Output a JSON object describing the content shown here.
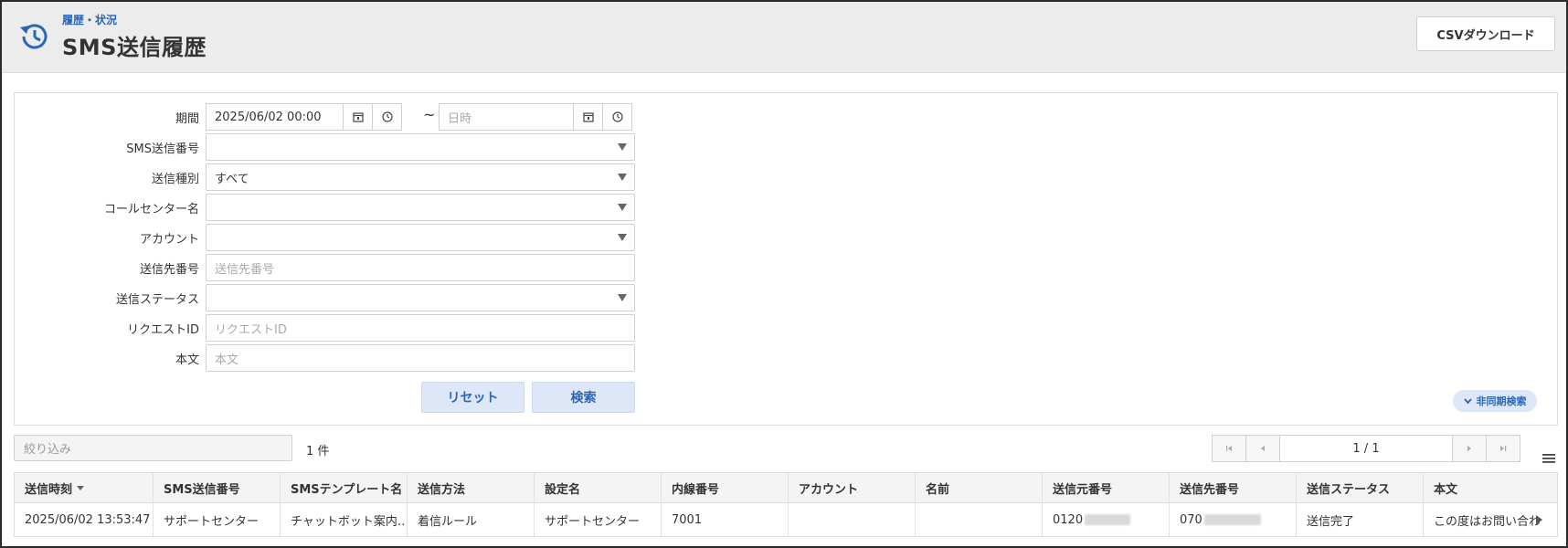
{
  "header": {
    "breadcrumb": "履歴・状況",
    "title": "SMS送信履歴",
    "csv_button": "CSVダウンロード",
    "icon": "history-icon"
  },
  "form": {
    "period": {
      "label": "期間",
      "from_value": "2025/06/02 00:00",
      "to_placeholder": "日時",
      "separator": "~"
    },
    "sms_number": {
      "label": "SMS送信番号",
      "value": ""
    },
    "send_type": {
      "label": "送信種別",
      "value": "すべて"
    },
    "call_center": {
      "label": "コールセンター名",
      "value": ""
    },
    "account": {
      "label": "アカウント",
      "value": ""
    },
    "dest_number": {
      "label": "送信先番号",
      "placeholder": "送信先番号"
    },
    "send_status": {
      "label": "送信ステータス",
      "value": ""
    },
    "request_id": {
      "label": "リクエストID",
      "placeholder": "リクエストID"
    },
    "body": {
      "label": "本文",
      "placeholder": "本文"
    },
    "reset_button": "リセット",
    "search_button": "検索",
    "async_button": "非同期検索"
  },
  "results": {
    "filter_placeholder": "絞り込み",
    "count": "1 件",
    "pager_text": "1 / 1"
  },
  "table": {
    "columns": [
      "送信時刻",
      "SMS送信番号",
      "SMSテンプレート名",
      "送信方法",
      "設定名",
      "内線番号",
      "アカウント",
      "名前",
      "送信元番号",
      "送信先番号",
      "送信ステータス",
      "本文"
    ],
    "rows": [
      {
        "time": "2025/06/02 13:53:47",
        "sms_number": "サポートセンター",
        "template": "チャットボット案内…",
        "method": "着信ルール",
        "setting": "サポートセンター",
        "extension": "7001",
        "account": "",
        "name": "",
        "from_prefix": "0120",
        "to_prefix": "070",
        "status": "送信完了",
        "body": "この度はお問い合わ"
      }
    ]
  },
  "colors": {
    "accent": "#2a66b5",
    "header_bg": "#ececec",
    "button_bg": "#dde7f7"
  }
}
